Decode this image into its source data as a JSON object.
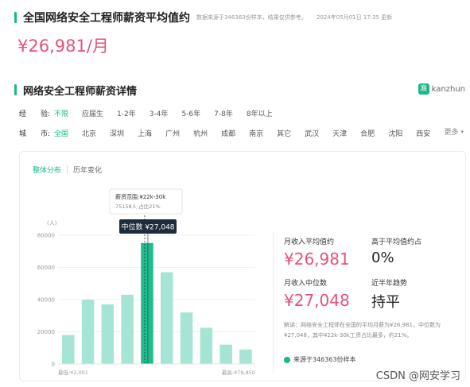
{
  "header": {
    "title": "全国网络安全工程师薪资平均值约",
    "note_source": "数据来源于346363份样本，结果仅供参考。",
    "note_time": "2024年05月01日 17:35 更新",
    "average_salary": "¥26,981/月"
  },
  "section": {
    "title": "网络安全工程师薪资详情",
    "brand_logo": "准",
    "brand_name": "kanzhun"
  },
  "filters": {
    "experience_label": "经　　验:",
    "experience_options": [
      "不限",
      "应届生",
      "1-2年",
      "3-4年",
      "5-6年",
      "7-8年",
      "8年以上"
    ],
    "city_label": "城　　市:",
    "city_options": [
      "全国",
      "北京",
      "深圳",
      "上海",
      "广州",
      "杭州",
      "成都",
      "南京",
      "其它",
      "武汉",
      "天津",
      "合肥",
      "沈阳",
      "西安"
    ],
    "more_label": "更多"
  },
  "tabs": [
    "整体分布",
    "历年变化"
  ],
  "chart_data": {
    "type": "bar",
    "ylabel": "(人)",
    "y_ticks": [
      "80000",
      "60000",
      "40000",
      "20000",
      "0"
    ],
    "ylim": [
      0,
      80000
    ],
    "values": [
      18000,
      40000,
      37000,
      43000,
      75158,
      57000,
      32000,
      22500,
      12000,
      9000
    ],
    "highlight_index": 4,
    "x_start_label": "最低:¥2,001",
    "x_end_label": "最高:¥79,850",
    "tooltip_title": "薪资范围:¥22k-30k",
    "tooltip_detail": "75158人 占比21%",
    "median_label": "中位数 ¥27,048",
    "colors": {
      "bar": "#a6e5d5",
      "highlight": "#1ebc8f"
    }
  },
  "stats": {
    "avg_label": "月收入平均值约",
    "avg_value": "¥26,981",
    "above_label": "高于平均值约占",
    "above_value": "0%",
    "median_label": "月收入中位数",
    "median_value": "¥27,048",
    "trend_label": "近半年趋势",
    "trend_value": "持平"
  },
  "analysis": "解读：网络安全工程师在全国的平均月薪为¥26,981，中位数为¥27,048，其中¥22k-30k工资占比最多，约21%。",
  "source": "来源于346363份样本",
  "watermark": "CSDN @网安学习"
}
